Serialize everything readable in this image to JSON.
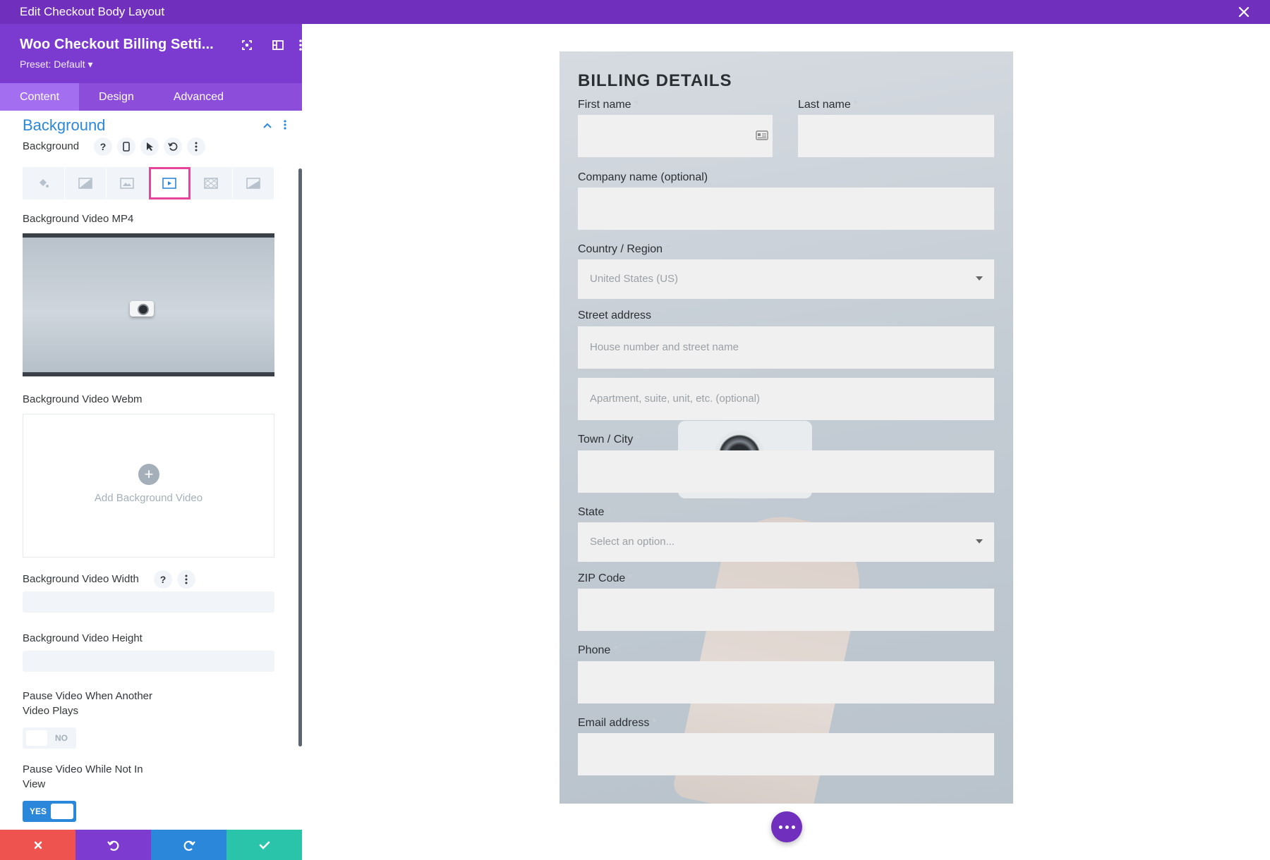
{
  "window": {
    "title": "Edit Checkout Body Layout"
  },
  "module": {
    "title": "Woo Checkout Billing Setti...",
    "preset": "Preset: Default ▾",
    "tabs": [
      "Content",
      "Design",
      "Advanced"
    ]
  },
  "section": {
    "title": "Background",
    "background_label": "Background",
    "help_glyph": "?",
    "bg_types": [
      "color",
      "gradient",
      "image",
      "video",
      "pattern",
      "mask"
    ],
    "active_bg_type": "video",
    "video_mp4_label": "Background Video MP4",
    "video_webm_label": "Background Video Webm",
    "add_video_label": "Add Background Video",
    "video_width_label": "Background Video Width",
    "video_height_label": "Background Video Height",
    "pause_other_label_1": "Pause Video When Another",
    "pause_other_label_2": "Video Plays",
    "pause_other_value": "NO",
    "pause_view_label_1": "Pause Video While Not In",
    "pause_view_label_2": "View",
    "pause_view_value": "YES"
  },
  "footer": {
    "colors": {
      "cancel": "#ef5350",
      "undo": "#7e3bd0",
      "redo": "#2b87da",
      "save": "#29c4a9"
    }
  },
  "billing": {
    "title": "BILLING DETAILS",
    "first_name": "First name",
    "last_name": "Last name",
    "company": "Company name (optional)",
    "country": "Country / Region",
    "country_value": "United States (US)",
    "street": "Street address",
    "street_ph1": "House number and street name",
    "street_ph2": "Apartment, suite, unit, etc. (optional)",
    "city": "Town / City",
    "state": "State",
    "state_value": "Select an option...",
    "zip": "ZIP Code",
    "phone": "Phone",
    "email": "Email address",
    "required_mark": "*"
  },
  "colors": {
    "accent": "#7030bd",
    "blue": "#2b87da",
    "highlight": "#e6449a"
  }
}
